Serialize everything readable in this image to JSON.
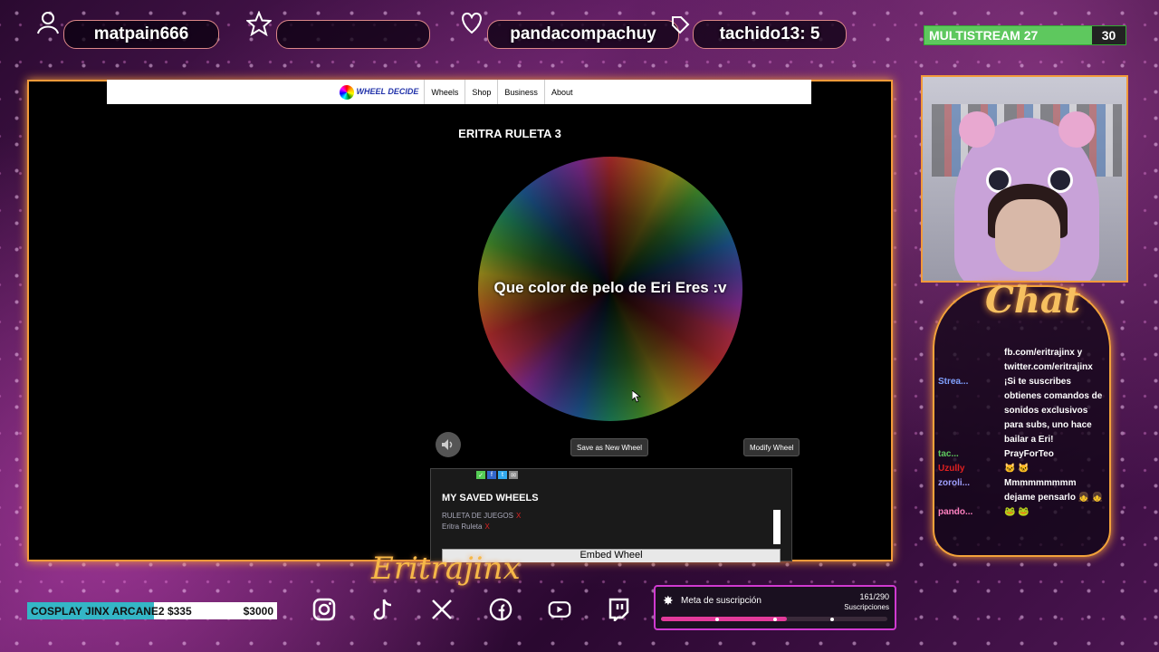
{
  "top_bar": {
    "slot1": {
      "icon": "user-icon",
      "text": "matpain666"
    },
    "slot2": {
      "icon": "star-icon",
      "text": ""
    },
    "slot3": {
      "icon": "heart-icon",
      "text": "pandacompachuy"
    },
    "slot4": {
      "icon": "tag-icon",
      "text": "tachido13: 5"
    },
    "multistream": {
      "label": "MULTISTREAM",
      "current": "27",
      "goal": "30"
    }
  },
  "browser": {
    "logo_text": "WHEEL DECIDE",
    "nav": [
      "Wheels",
      "Shop",
      "Business",
      "About"
    ],
    "wheel_title": "ERITRA RULETA 3",
    "wheel_question": "Que color de pelo de Eri Eres :v",
    "buttons": {
      "save_new": "Save as New Wheel",
      "modify": "Modify Wheel"
    },
    "saved": {
      "heading": "MY SAVED WHEELS",
      "items": [
        "RULETA DE JUEGOS",
        "Eritra Ruleta"
      ],
      "remove": "X",
      "embed": "Embed Wheel"
    }
  },
  "chat": {
    "title": "Chat",
    "messages": [
      {
        "user": "",
        "user_color": "#ffffff",
        "text": "fb.com/eritrajinx y twitter.com/eritrajinx"
      },
      {
        "user": "Strea...",
        "user_color": "#7fa0ff",
        "text": "¡Si te suscribes obtienes comandos de sonidos exclusivos para subs, uno hace bailar a Eri!"
      },
      {
        "user": "tac...",
        "user_color": "#5ec85e",
        "text": "PrayForTeo"
      },
      {
        "user": "Uzully",
        "user_color": "#e02020",
        "text": "🐱 🐱"
      },
      {
        "user": "zoroli...",
        "user_color": "#a0a0ff",
        "text": "Mmmmmmmmm dejame pensarlo 👧 👧"
      },
      {
        "user": "pando...",
        "user_color": "#ff80c0",
        "text": "🐸 🐸"
      }
    ]
  },
  "bottom": {
    "goal_label": "COSPLAY JINX ARCANE2",
    "goal_current": "$335",
    "goal_target": "$3000",
    "social_icons": [
      "instagram-icon",
      "tiktok-icon",
      "x-icon",
      "facebook-icon",
      "youtube-icon",
      "twitch-icon"
    ],
    "sub_goal": {
      "label": "Meta de suscripción",
      "count": "161/290",
      "unit": "Suscripciones",
      "progress": 0.555
    },
    "signature": "Eritrajinx"
  },
  "colors": {
    "accent_orange": "#f39a3a",
    "pink": "#d03ad0",
    "multistream_green": "#5ec85e",
    "goal_cyan": "#34b6c6"
  }
}
